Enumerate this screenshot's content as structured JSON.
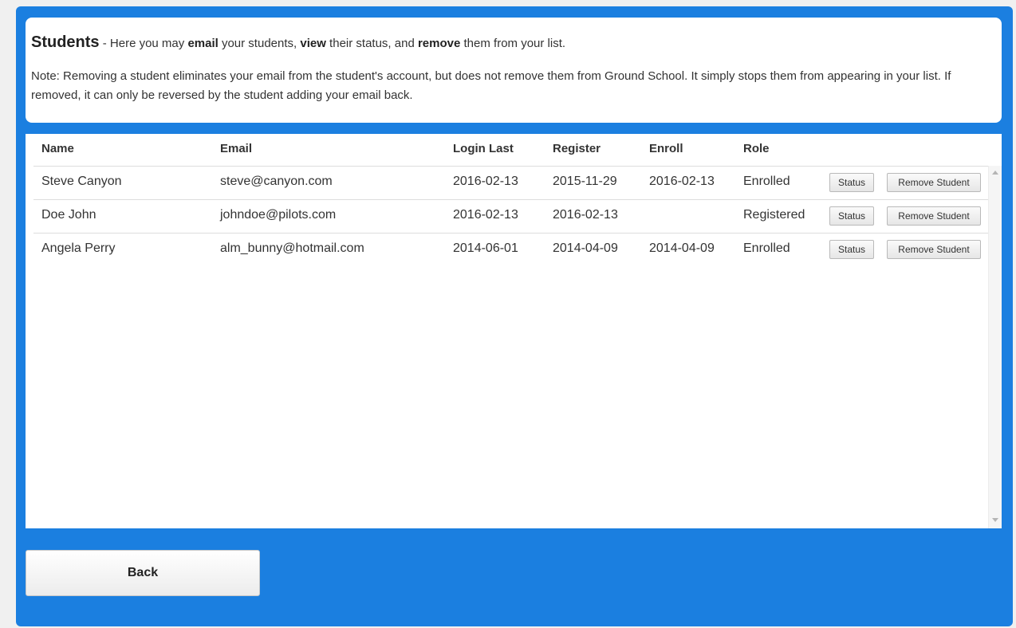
{
  "intro": {
    "title": "Students",
    "t1": " - Here you may ",
    "k1": "email",
    "t2": " your students, ",
    "k2": "view",
    "t3": " their status, and ",
    "k3": "remove",
    "t4": " them from your list."
  },
  "note": "Note: Removing a student eliminates your email from the student's account, but does not remove them from Ground School. It simply stops them from appearing in your list. If removed, it can only be reversed by the student adding your email back.",
  "table": {
    "headers": {
      "name": "Name",
      "email": "Email",
      "login_last": "Login Last",
      "register": "Register",
      "enroll": "Enroll",
      "role": "Role"
    },
    "rows": [
      {
        "name": "Steve Canyon",
        "email": "steve@canyon.com",
        "login_last": "2016-02-13",
        "register": "2015-11-29",
        "enroll": "2016-02-13",
        "role": "Enrolled"
      },
      {
        "name": "Doe John",
        "email": "johndoe@pilots.com",
        "login_last": "2016-02-13",
        "register": "2016-02-13",
        "enroll": "",
        "role": "Registered"
      },
      {
        "name": "Angela Perry",
        "email": "alm_bunny@hotmail.com",
        "login_last": "2014-06-01",
        "register": "2014-04-09",
        "enroll": "2014-04-09",
        "role": "Enrolled"
      }
    ],
    "status_label": "Status",
    "remove_label": "Remove Student"
  },
  "back_label": "Back",
  "colors": {
    "frame": "#1b7fe0",
    "panel": "#ffffff"
  }
}
